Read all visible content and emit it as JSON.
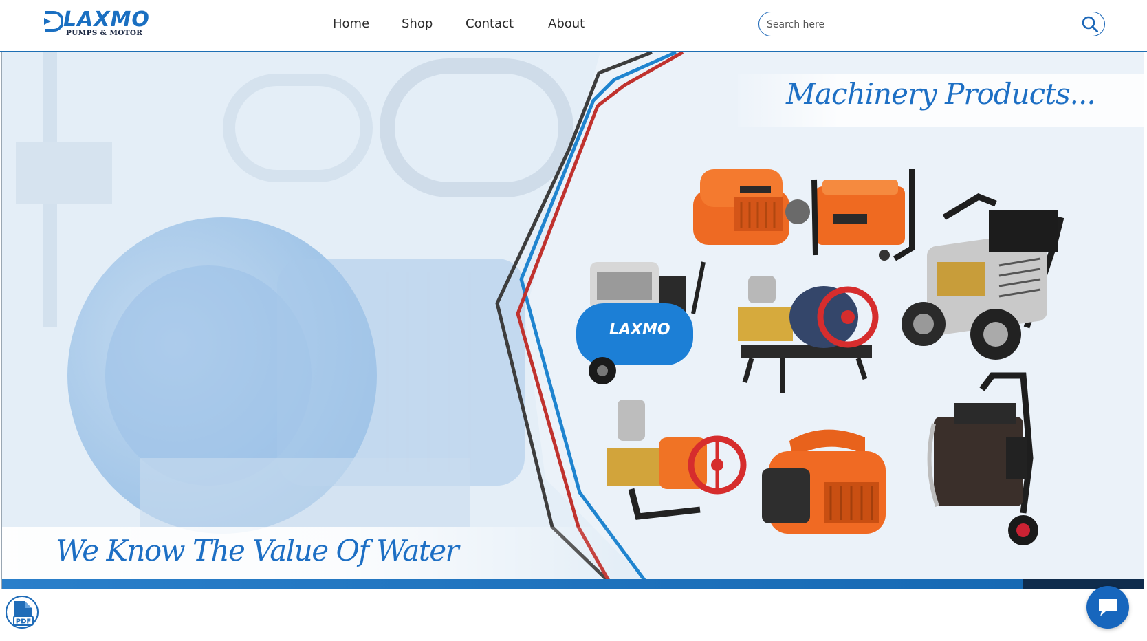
{
  "brand": {
    "logo_word": "LAXMO",
    "logo_subtitle": "PUMPS & MOTOR"
  },
  "nav": {
    "items": [
      "Home",
      "Shop",
      "Contact",
      "About"
    ]
  },
  "search": {
    "placeholder": "Search here",
    "value": ""
  },
  "hero": {
    "title": "Machinery Products...",
    "tagline": "We Know The Value Of Water"
  },
  "floating": {
    "pdf_label": "PDF"
  },
  "colors": {
    "brand_blue": "#1d6fc4",
    "accent_red": "#c0322e",
    "accent_dark": "#3d3d3d",
    "orange": "#f06a22"
  },
  "icons": [
    "search-icon",
    "pdf-icon",
    "chat-bubble-icon",
    "logo-mark-icon"
  ]
}
